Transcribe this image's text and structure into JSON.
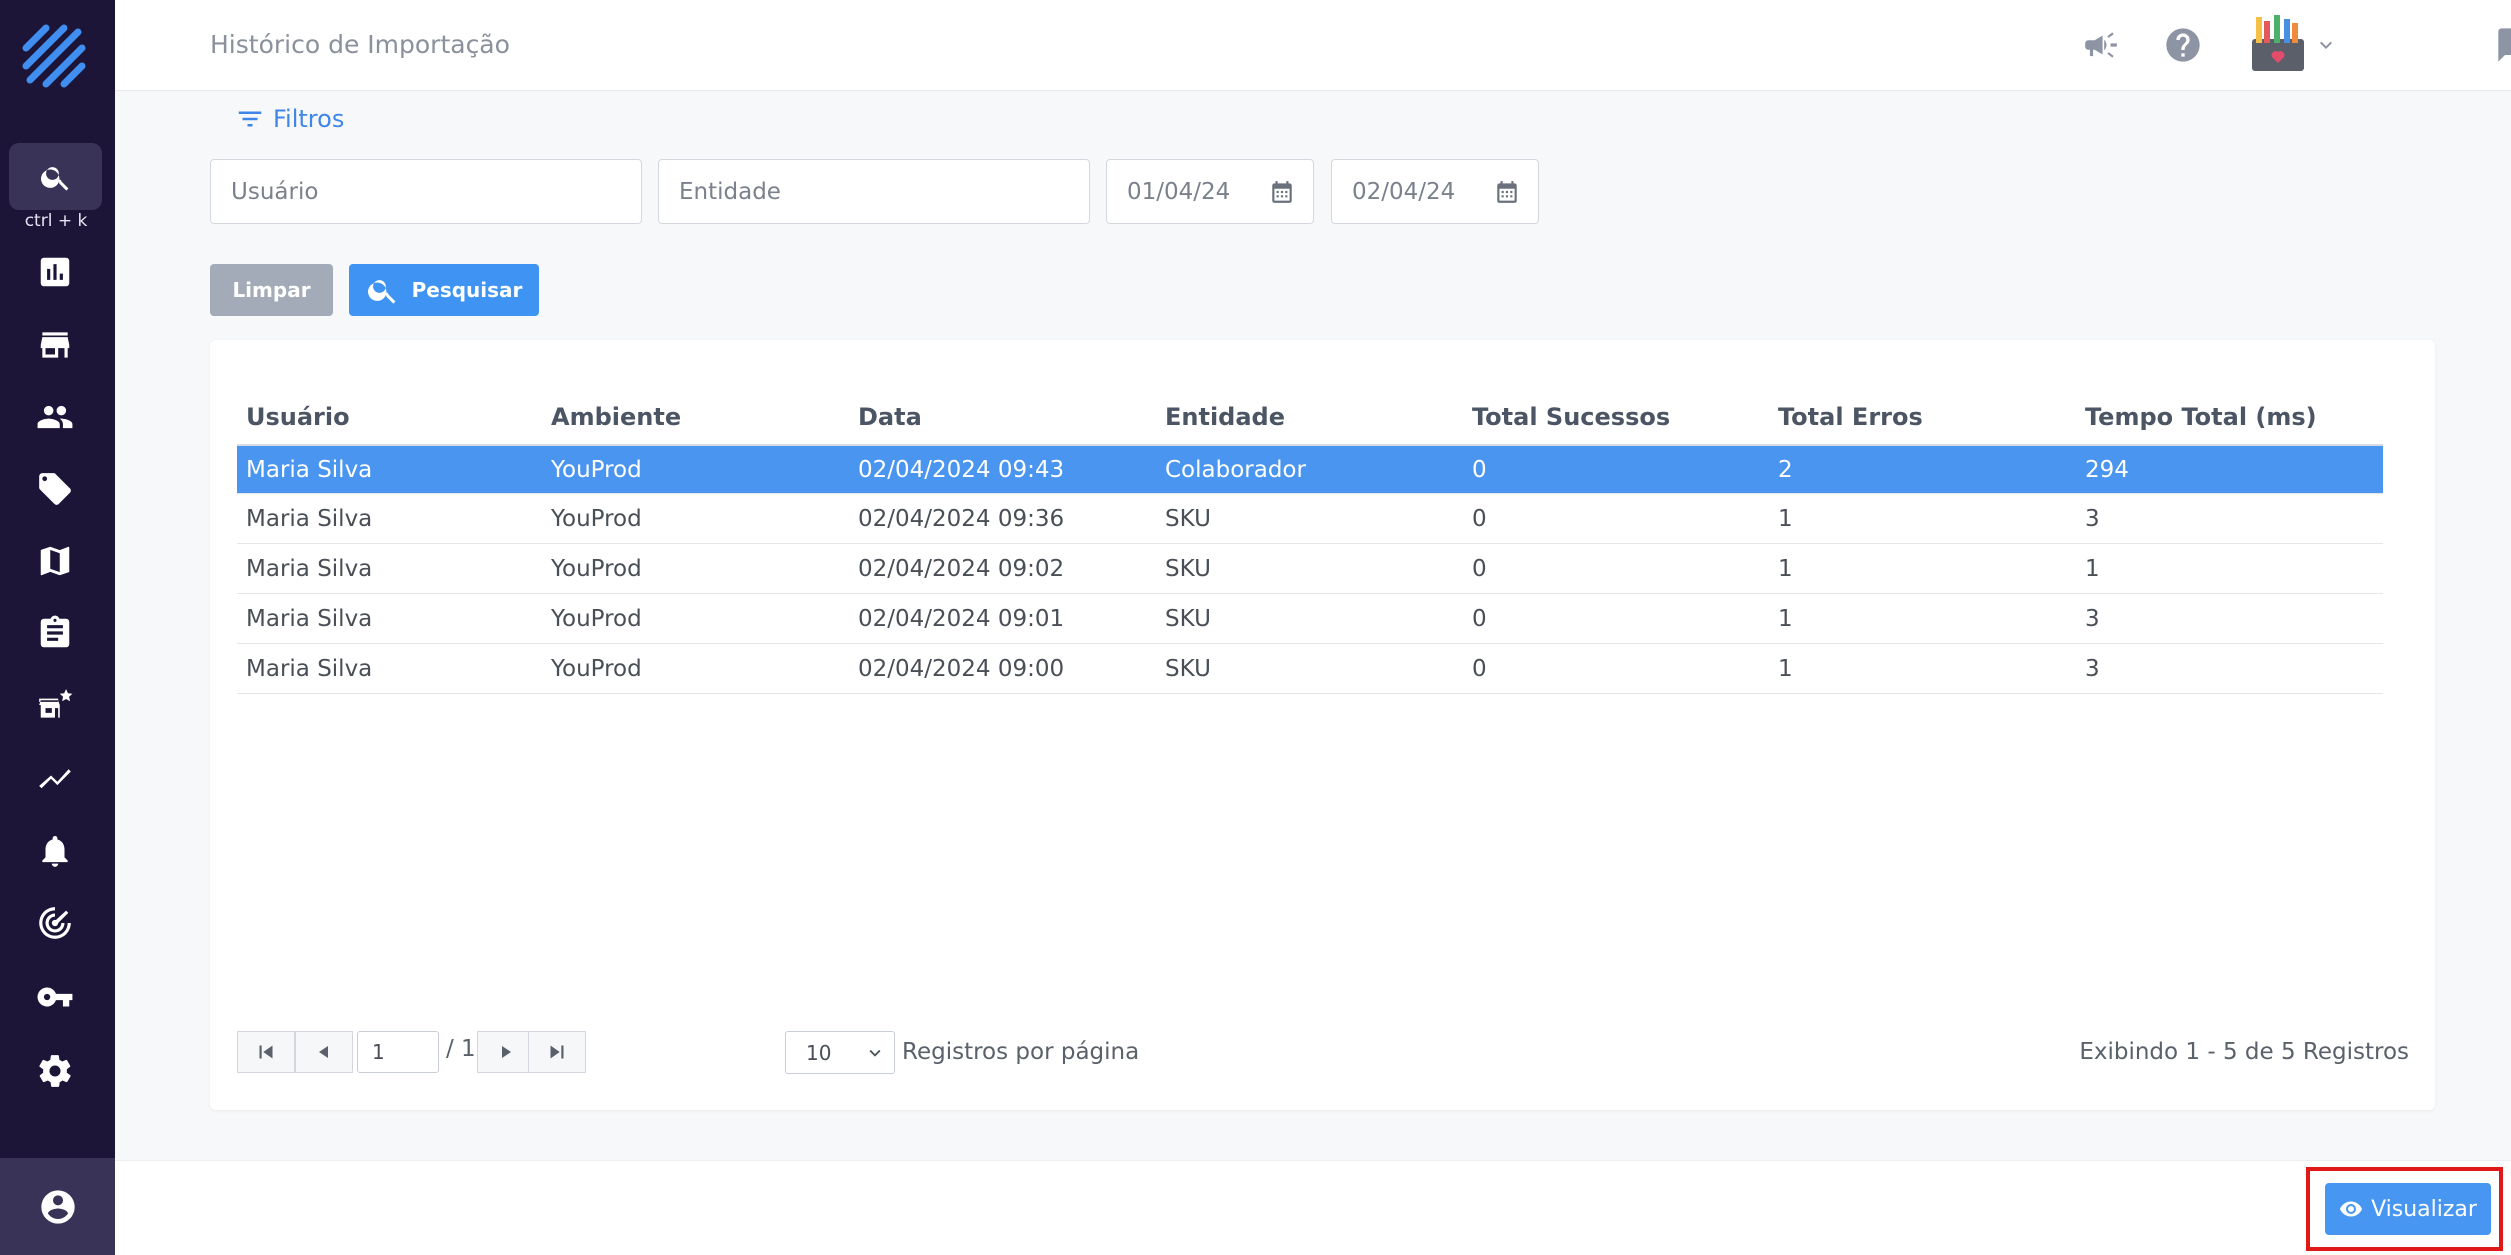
{
  "header": {
    "title": "Histórico de Importação"
  },
  "sidebar": {
    "search_shortcut": "ctrl + k",
    "items": [
      {
        "icon": "bar-chart-icon"
      },
      {
        "icon": "store-icon"
      },
      {
        "icon": "people-icon"
      },
      {
        "icon": "tag-icon"
      },
      {
        "icon": "map-icon"
      },
      {
        "icon": "clipboard-icon"
      },
      {
        "icon": "store-star-icon"
      },
      {
        "icon": "trending-icon"
      },
      {
        "icon": "bell-icon"
      },
      {
        "icon": "radar-icon"
      },
      {
        "icon": "key-icon"
      },
      {
        "icon": "gear-icon"
      }
    ],
    "bottom_icon": "user-circle-icon"
  },
  "filters": {
    "label": "Filtros",
    "usuario_placeholder": "Usuário",
    "entidade_placeholder": "Entidade",
    "date_from": "01/04/24",
    "date_to": "02/04/24",
    "clear_label": "Limpar",
    "search_label": "Pesquisar"
  },
  "table": {
    "columns": [
      "Usuário",
      "Ambiente",
      "Data",
      "Entidade",
      "Total Sucessos",
      "Total Erros",
      "Tempo Total (ms)"
    ],
    "rows": [
      [
        "Maria Silva",
        "YouProd",
        "02/04/2024 09:43",
        "Colaborador",
        "0",
        "2",
        "294"
      ],
      [
        "Maria Silva",
        "YouProd",
        "02/04/2024 09:36",
        "SKU",
        "0",
        "1",
        "3"
      ],
      [
        "Maria Silva",
        "YouProd",
        "02/04/2024 09:02",
        "SKU",
        "0",
        "1",
        "1"
      ],
      [
        "Maria Silva",
        "YouProd",
        "02/04/2024 09:01",
        "SKU",
        "0",
        "1",
        "3"
      ],
      [
        "Maria Silva",
        "YouProd",
        "02/04/2024 09:00",
        "SKU",
        "0",
        "1",
        "3"
      ]
    ],
    "selected_row": 0
  },
  "pagination": {
    "current_page": "1",
    "total_pages": "/ 1",
    "per_page": "10",
    "per_page_label": "Registros por página",
    "showing": "Exibindo 1 - 5 de 5 Registros"
  },
  "footer": {
    "view_label": "Visualizar"
  },
  "colors": {
    "sidebar": "#1c1538",
    "accent": "#3f93f2",
    "selected_row": "#4a95f0",
    "highlight": "#e01818"
  }
}
